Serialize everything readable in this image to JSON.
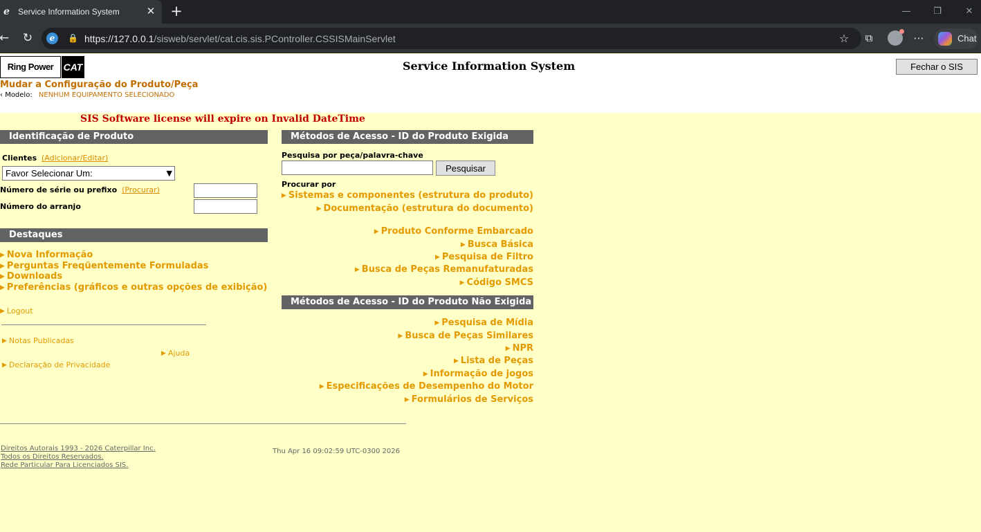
{
  "browser": {
    "tab_title": "Service Information System",
    "url_host": "https://127.0.0.1",
    "url_path": "/sisweb/servlet/cat.cis.sis.PController.CSSISMainServlet",
    "chat_label": "Chat"
  },
  "header": {
    "logo_text": "Ring Power",
    "logo_cat": "CAT",
    "title": "Service Information System",
    "close_button": "Fechar o  SIS",
    "subtitle": "Mudar a Configuração do Produto/Peça",
    "model_label": "Modelo:",
    "model_value": "NENHUM EQUIPAMENTO SELECIONADO",
    "license_warning": "SIS Software license will expire on Invalid DateTime"
  },
  "product_id": {
    "header": "Identificação de Produto",
    "clientes_label": "Clientes",
    "clientes_link": "(Adicionar/Editar)",
    "clientes_selected": "Favor Selecionar Um:",
    "serial_label": "Número de série ou prefixo",
    "serial_link": "(Procurar)",
    "arrangement_label": "Número do arranjo"
  },
  "highlights": {
    "header": "Destaques",
    "items": [
      "Nova Informação",
      "Perguntas Freqüentemente Formuladas",
      "Downloads",
      "Preferências (gráficos e outras opções de exibição)"
    ],
    "logout": "Logout",
    "notas": "Notas Publicadas",
    "ajuda": "Ajuda",
    "privacidade": "Declaração de Privacidade"
  },
  "access_required": {
    "header": "Métodos de Acesso - ID do Produto Exigida",
    "search_label": "Pesquisa por peça/palavra-chave",
    "search_value": "",
    "search_button": "Pesquisar",
    "browse_label": "Procurar por",
    "links": [
      "Sistemas e componentes (estrutura do produto)",
      "Documentação (estrutura do documento)",
      "Produto Conforme Embarcado",
      "Busca Básica",
      "Pesquisa de Filtro",
      "Busca de Peças Remanufaturadas",
      "Código SMCS"
    ]
  },
  "access_not_required": {
    "header": "Métodos de Acesso - ID do Produto Não Exigida",
    "links": [
      "Pesquisa de Mídia",
      "Busca de Peças Similares",
      "NPR",
      "Lista de Peças",
      "Informação de jogos",
      "Especificações de Desempenho do Motor",
      "Formulários de Serviços"
    ]
  },
  "footer": {
    "copyright": "Direitos Autorais 1993 - 2026 Caterpillar Inc.",
    "rights": "Todos os Direitos Reservados.",
    "network": "Rede Particular Para Licenciados SIS.",
    "timestamp": "Thu Apr 16 09:02:59 UTC-0300 2026"
  },
  "colors": {
    "page_bg": "#ffffc8",
    "link": "#e39a00",
    "subtitle": "#c06e00",
    "section_header": "#636363",
    "warning": "#c00000"
  }
}
